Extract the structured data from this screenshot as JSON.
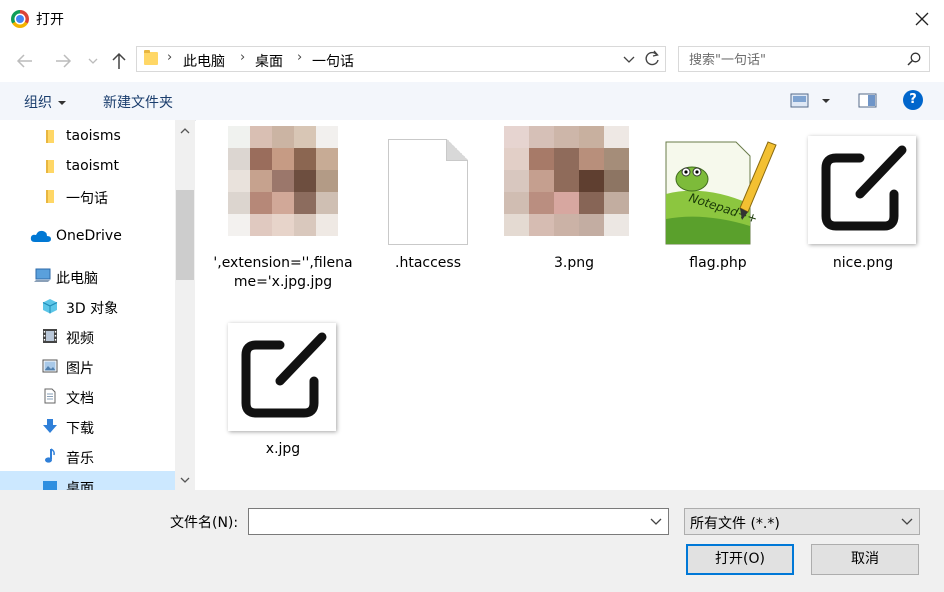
{
  "window": {
    "title": "打开"
  },
  "address": {
    "breadcrumbs": [
      "此电脑",
      "桌面",
      "一句话"
    ]
  },
  "search": {
    "placeholder": "搜索\"一句话\""
  },
  "toolbar": {
    "organize_label": "组织",
    "new_folder_label": "新建文件夹",
    "help_label": "?"
  },
  "sidebar": {
    "items": [
      {
        "label": "taoisms",
        "icon": "folder-icon"
      },
      {
        "label": "taoismt",
        "icon": "folder-icon"
      },
      {
        "label": "一句话",
        "icon": "folder-icon"
      },
      {
        "label": "OneDrive",
        "icon": "cloud-icon"
      },
      {
        "label": "此电脑",
        "icon": "computer-icon"
      },
      {
        "label": "3D 对象",
        "icon": "cube-icon"
      },
      {
        "label": "视频",
        "icon": "video-icon"
      },
      {
        "label": "图片",
        "icon": "picture-icon"
      },
      {
        "label": "文档",
        "icon": "document-icon"
      },
      {
        "label": "下载",
        "icon": "download-icon"
      },
      {
        "label": "音乐",
        "icon": "music-icon"
      },
      {
        "label": "桌面",
        "icon": "desktop-icon"
      }
    ]
  },
  "files": [
    {
      "name": "',extension='',filename='x.jpg.jpg",
      "kind": "image"
    },
    {
      "name": ".htaccess",
      "kind": "document"
    },
    {
      "name": "3.png",
      "kind": "image"
    },
    {
      "name": "flag.php",
      "kind": "notepad"
    },
    {
      "name": "nice.png",
      "kind": "edit-image"
    },
    {
      "name": "x.jpg",
      "kind": "edit-image"
    }
  ],
  "footer": {
    "filename_label": "文件名(N):",
    "filename_value": "",
    "filetype_value": "所有文件 (*.*)",
    "open_label": "打开(O)",
    "cancel_label": "取消"
  }
}
